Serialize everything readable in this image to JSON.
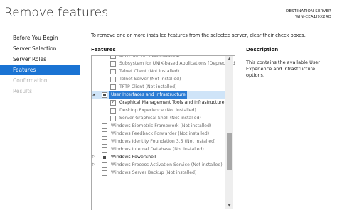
{
  "header": {
    "title": "Remove features",
    "destination_label": "DESTINATION SERVER",
    "destination_server": "WIN-CEA1I9X24Q"
  },
  "nav": {
    "items": [
      {
        "label": "Before You Begin",
        "state": "normal"
      },
      {
        "label": "Server Selection",
        "state": "normal"
      },
      {
        "label": "Server Roles",
        "state": "normal"
      },
      {
        "label": "Features",
        "state": "active"
      },
      {
        "label": "Confirmation",
        "state": "disabled"
      },
      {
        "label": "Results",
        "state": "disabled"
      }
    ]
  },
  "main": {
    "instructions": "To remove one or more installed features from the selected server, clear their check boxes.",
    "features_heading": "Features",
    "description_heading": "Description",
    "description_text": "This contains the available User Experience and Infrastructure options."
  },
  "features": [
    {
      "label": "SMTP Server (Not installed)",
      "indent": 1,
      "checkbox": "none",
      "expander": "",
      "installed": false
    },
    {
      "label": "Subsystem for UNIX-based Applications [Deprecated]",
      "indent": 1,
      "checkbox": "none",
      "expander": "",
      "installed": false
    },
    {
      "label": "Telnet Client (Not installed)",
      "indent": 1,
      "checkbox": "none",
      "expander": "",
      "installed": false
    },
    {
      "label": "Telnet Server (Not installed)",
      "indent": 1,
      "checkbox": "none",
      "expander": "",
      "installed": false
    },
    {
      "label": "TFTP Client (Not installed)",
      "indent": 1,
      "checkbox": "none",
      "expander": "",
      "installed": false
    },
    {
      "label": "User Interfaces and Infrastructure",
      "indent": 0,
      "checkbox": "partial",
      "expander": "expanded",
      "installed": true,
      "selected": true
    },
    {
      "label": "Graphical Management Tools and Infrastructure",
      "indent": 1,
      "checkbox": "checked",
      "expander": "",
      "installed": true
    },
    {
      "label": "Desktop Experience (Not installed)",
      "indent": 1,
      "checkbox": "none",
      "expander": "",
      "installed": false
    },
    {
      "label": "Server Graphical Shell (Not installed)",
      "indent": 1,
      "checkbox": "none",
      "expander": "",
      "installed": false
    },
    {
      "label": "Windows Biometric Framework (Not installed)",
      "indent": 0,
      "checkbox": "none",
      "expander": "",
      "installed": false
    },
    {
      "label": "Windows Feedback Forwarder (Not installed)",
      "indent": 0,
      "checkbox": "none",
      "expander": "",
      "installed": false
    },
    {
      "label": "Windows Identity Foundation 3.5 (Not installed)",
      "indent": 0,
      "checkbox": "none",
      "expander": "",
      "installed": false
    },
    {
      "label": "Windows Internal Database (Not installed)",
      "indent": 0,
      "checkbox": "none",
      "expander": "",
      "installed": false
    },
    {
      "label": "Windows PowerShell",
      "indent": 0,
      "checkbox": "partial",
      "expander": "collapsed",
      "installed": true
    },
    {
      "label": "Windows Process Activation Service (Not installed)",
      "indent": 0,
      "checkbox": "none",
      "expander": "collapsed",
      "installed": false
    },
    {
      "label": "Windows Server Backup (Not installed)",
      "indent": 0,
      "checkbox": "none",
      "expander": "",
      "installed": false
    }
  ],
  "colors": {
    "accent": "#1a73d3",
    "selected_row": "#cfe4f8",
    "disabled_text": "#b6b6b6"
  }
}
